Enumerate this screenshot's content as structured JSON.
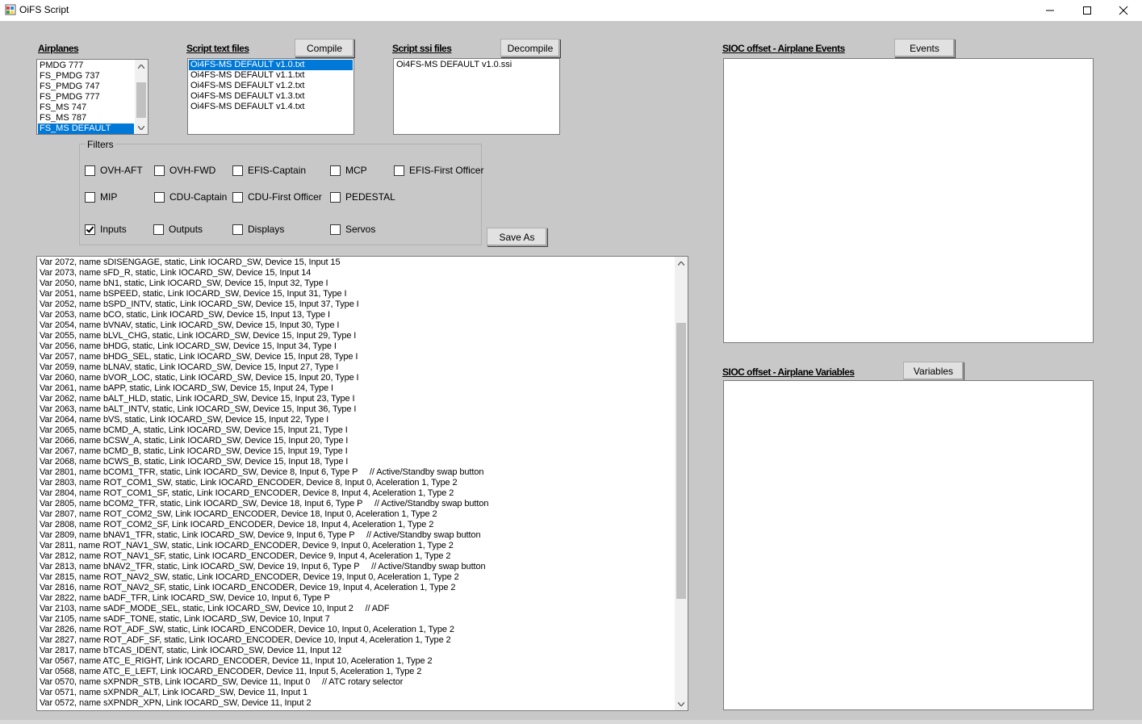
{
  "window": {
    "title": "OiFS Script"
  },
  "airplanes": {
    "label": "Airplanes",
    "items": [
      {
        "label": "PMDG 777",
        "selected": false
      },
      {
        "label": "FS_PMDG 737",
        "selected": false
      },
      {
        "label": "FS_PMDG 747",
        "selected": false
      },
      {
        "label": "FS_PMDG 777",
        "selected": false
      },
      {
        "label": "FS_MS 747",
        "selected": false
      },
      {
        "label": "FS_MS 787",
        "selected": false
      },
      {
        "label": "FS_MS DEFAULT",
        "selected": true
      }
    ]
  },
  "script_text": {
    "label": "Script text files",
    "button": "Compile",
    "items": [
      {
        "label": "Oi4FS-MS DEFAULT v1.0.txt",
        "selected": true
      },
      {
        "label": "Oi4FS-MS DEFAULT v1.1.txt",
        "selected": false
      },
      {
        "label": "Oi4FS-MS DEFAULT v1.2.txt",
        "selected": false
      },
      {
        "label": "Oi4FS-MS DEFAULT v1.3.txt",
        "selected": false
      },
      {
        "label": "Oi4FS-MS DEFAULT v1.4.txt",
        "selected": false
      }
    ]
  },
  "script_ssi": {
    "label": "Script ssi files",
    "button": "Decompile",
    "items": [
      {
        "label": "Oi4FS-MS DEFAULT v1.0.ssi",
        "selected": false
      }
    ]
  },
  "filters": {
    "title": "Filters",
    "items": [
      {
        "label": "OVH-AFT",
        "checked": false
      },
      {
        "label": "OVH-FWD",
        "checked": false
      },
      {
        "label": "EFIS-Captain",
        "checked": false
      },
      {
        "label": "MCP",
        "checked": false
      },
      {
        "label": "EFIS-First Officer",
        "checked": false
      },
      {
        "label": "MIP",
        "checked": false
      },
      {
        "label": "CDU-Captain",
        "checked": false
      },
      {
        "label": "CDU-First Officer",
        "checked": false
      },
      {
        "label": "PEDESTAL",
        "checked": false
      },
      {
        "label": "Inputs",
        "checked": true
      },
      {
        "label": "Outputs",
        "checked": false
      },
      {
        "label": "Displays",
        "checked": false
      },
      {
        "label": "Servos",
        "checked": false
      }
    ]
  },
  "save_as": "Save As",
  "events": {
    "label": "SIOC offset - Airplane Events",
    "button": "Events"
  },
  "variables": {
    "label": "SIOC offset - Airplane Variables",
    "button": "Variables"
  },
  "code_lines": [
    "Var 2072, name sDISENGAGE, static, Link IOCARD_SW, Device 15, Input 15",
    "Var 2073, name sFD_R, static, Link IOCARD_SW, Device 15, Input 14",
    "Var 2050, name bN1, static, Link IOCARD_SW, Device 15, Input 32, Type I",
    "Var 2051, name bSPEED, static, Link IOCARD_SW, Device 15, Input 31, Type I",
    "Var 2052, name bSPD_INTV, static, Link IOCARD_SW, Device 15, Input 37, Type I",
    "Var 2053, name bCO, static, Link IOCARD_SW, Device 15, Input 13, Type I",
    "Var 2054, name bVNAV, static, Link IOCARD_SW, Device 15, Input 30, Type I",
    "Var 2055, name bLVL_CHG, static, Link IOCARD_SW, Device 15, Input 29, Type I",
    "Var 2056, name bHDG, static, Link IOCARD_SW, Device 15, Input 34, Type I",
    "Var 2057, name bHDG_SEL, static, Link IOCARD_SW, Device 15, Input 28, Type I",
    "Var 2059, name bLNAV, static, Link IOCARD_SW, Device 15, Input 27, Type I",
    "Var 2060, name bVOR_LOC, static, Link IOCARD_SW, Device 15, Input 20, Type I",
    "Var 2061, name bAPP, static, Link IOCARD_SW, Device 15, Input 24, Type I",
    "Var 2062, name bALT_HLD, static, Link IOCARD_SW, Device 15, Input 23, Type I",
    "Var 2063, name bALT_INTV, static, Link IOCARD_SW, Device 15, Input 36, Type I",
    "Var 2064, name bVS, static, Link IOCARD_SW, Device 15, Input 22, Type I",
    "Var 2065, name bCMD_A, static, Link IOCARD_SW, Device 15, Input 21, Type I",
    "Var 2066, name bCSW_A, static, Link IOCARD_SW, Device 15, Input 20, Type I",
    "Var 2067, name bCMD_B, static, Link IOCARD_SW, Device 15, Input 19, Type I",
    "Var 2068, name bCWS_B, static, Link IOCARD_SW, Device 15, Input 18, Type I",
    "Var 2801, name bCOM1_TFR, static, Link IOCARD_SW, Device 8, Input 6, Type P     // Active/Standby swap button",
    "Var 2803, name ROT_COM1_SW, static, Link IOCARD_ENCODER, Device 8, Input 0, Aceleration 1, Type 2",
    "Var 2804, name ROT_COM1_SF, static, Link IOCARD_ENCODER, Device 8, Input 4, Aceleration 1, Type 2",
    "Var 2805, name bCOM2_TFR, static, Link IOCARD_SW, Device 18, Input 6, Type P     // Active/Standby swap button",
    "Var 2807, name ROT_COM2_SW, Link IOCARD_ENCODER, Device 18, Input 0, Aceleration 1, Type 2",
    "Var 2808, name ROT_COM2_SF, Link IOCARD_ENCODER, Device 18, Input 4, Aceleration 1, Type 2",
    "Var 2809, name bNAV1_TFR, static, Link IOCARD_SW, Device 9, Input 6, Type P     // Active/Standby swap button",
    "Var 2811, name ROT_NAV1_SW, static, Link IOCARD_ENCODER, Device 9, Input 0, Aceleration 1, Type 2",
    "Var 2812, name ROT_NAV1_SF, static, Link IOCARD_ENCODER, Device 9, Input 4, Aceleration 1, Type 2",
    "Var 2813, name bNAV2_TFR, static, Link IOCARD_SW, Device 19, Input 6, Type P     // Active/Standby swap button",
    "Var 2815, name ROT_NAV2_SW, static, Link IOCARD_ENCODER, Device 19, Input 0, Aceleration 1, Type 2",
    "Var 2816, name ROT_NAV2_SF, static, Link IOCARD_ENCODER, Device 19, Input 4, Aceleration 1, Type 2",
    "Var 2822, name bADF_TFR, Link IOCARD_SW, Device 10, Input 6, Type P",
    "Var 2103, name sADF_MODE_SEL, static, Link IOCARD_SW, Device 10, Input 2     // ADF",
    "Var 2105, name sADF_TONE, static, Link IOCARD_SW, Device 10, Input 7",
    "Var 2826, name ROT_ADF_SW, static, Link IOCARD_ENCODER, Device 10, Input 0, Aceleration 1, Type 2",
    "Var 2827, name ROT_ADF_SF, static, Link IOCARD_ENCODER, Device 10, Input 4, Aceleration 1, Type 2",
    "Var 2817, name bTCAS_IDENT, static, Link IOCARD_SW, Device 11, Input 12",
    "Var 0567, name ATC_E_RIGHT, Link IOCARD_ENCODER, Device 11, Input 10, Aceleration 1, Type 2",
    "Var 0568, name ATC_E_LEFT, Link IOCARD_ENCODER, Device 11, Input 5, Aceleration 1, Type 2",
    "Var 0570, name sXPNDR_STB, Link IOCARD_SW, Device 11, Input 0     // ATC rotary selector",
    "Var 0571, name sXPNDR_ALT, Link IOCARD_SW, Device 11, Input 1",
    "Var 0572, name sXPNDR_XPN, Link IOCARD_SW, Device 11, Input 2"
  ]
}
